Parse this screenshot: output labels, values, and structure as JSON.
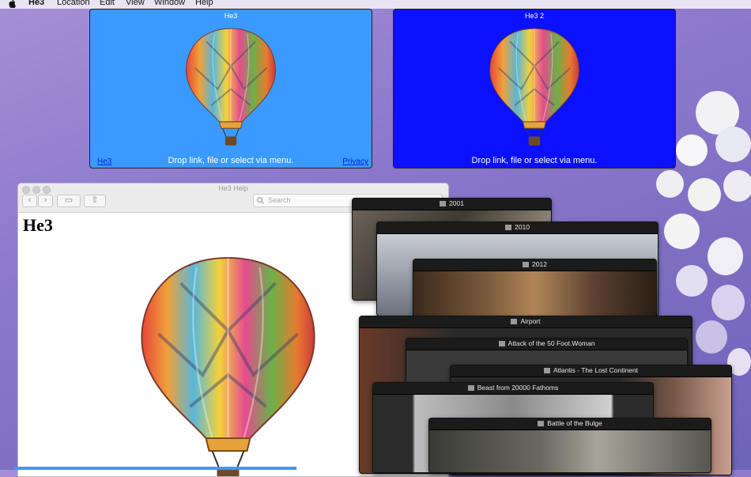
{
  "menubar": {
    "app_name": "He3",
    "items": [
      "Location",
      "Edit",
      "View",
      "Window",
      "Help"
    ]
  },
  "window_he3": {
    "title": "He3",
    "drop_text": "Drop link, file or select via menu.",
    "left_link": "He3",
    "right_link": "Privacy",
    "bg": "#3a9aff"
  },
  "window_he3_2": {
    "title": "He3 2",
    "drop_text": "Drop link, file or select via menu.",
    "bg": "#0b10ff"
  },
  "help_window": {
    "title": "He3 Help",
    "search_placeholder": "Search",
    "heading": "He3"
  },
  "movies": [
    "2001",
    "2010",
    "2012",
    "Airport",
    "Attack of the 50 Foot.Woman",
    "Atlantis - The Lost Continent",
    "Beast from 20000 Fathoms",
    "Battle of the Bulge"
  ]
}
